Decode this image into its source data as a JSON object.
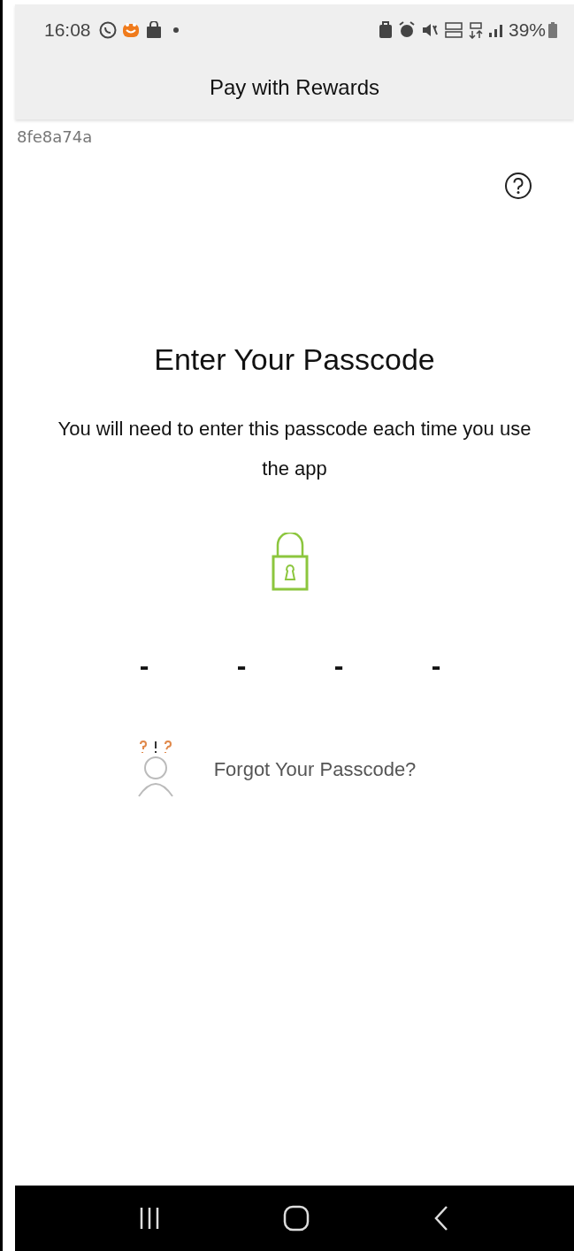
{
  "status_bar": {
    "time": "16:08",
    "battery": "39%"
  },
  "app_bar": {
    "title": "Pay with Rewards"
  },
  "device_code": "8fe8a74a",
  "heading": "Enter Your Passcode",
  "description": "You will need to enter this passcode each time you use the app",
  "passcode_slots": [
    "-",
    "-",
    "-",
    "-"
  ],
  "forgot_link": "Forgot Your Passcode?"
}
